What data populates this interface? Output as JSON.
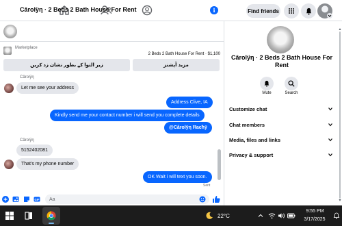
{
  "topnav": {
    "find_friends": "Find friends",
    "icons": [
      "home-icon",
      "friends-icon",
      "groups-icon",
      "menu-grid-icon",
      "messenger-icon",
      "notifications-icon",
      "profile-avatar"
    ]
  },
  "chat": {
    "title": "Cârolÿη · 2 Beds 2 Bath House For Rent",
    "info_icon": "i",
    "marketplace_label": "Marketplace",
    "listing": "2 Beds 2 Bath House For Rent · $1,100",
    "buttons": {
      "more_options": "مزید آپشنز",
      "mark_unavailable": "زیر التوا کے بطور نشان زد کریں"
    },
    "messages": [
      {
        "direction": "in",
        "sender": "Cârolÿη",
        "text": "Let me see your address"
      },
      {
        "direction": "out",
        "text": "Address Clive, IA"
      },
      {
        "direction": "out",
        "text": "Kindly send me your contact number i will send you complete details"
      },
      {
        "direction": "out",
        "text": "@Cârolÿη Ħacħÿ"
      },
      {
        "direction": "in",
        "sender": "Cârolÿη",
        "text": "5152402081"
      },
      {
        "direction": "in",
        "text": "That's my phone number"
      },
      {
        "direction": "out",
        "text": "OK Wait i will text you soon."
      }
    ],
    "status": "Sent",
    "composer_placeholder": "Aa"
  },
  "right_panel": {
    "title": "Cârolÿη · 2 Beds 2 Bath House For Rent",
    "actions": [
      {
        "label": "Mute",
        "icon": "bell-icon"
      },
      {
        "label": "Search",
        "icon": "search-icon"
      }
    ],
    "sections": [
      {
        "label": "Customize chat"
      },
      {
        "label": "Chat members"
      },
      {
        "label": "Media, files and links"
      },
      {
        "label": "Privacy & support"
      }
    ]
  },
  "taskbar": {
    "search_icon": "search-icon",
    "apps": [
      "file-explorer-icon",
      "chrome-icon"
    ],
    "weather": "22°C",
    "time": "9:55 PM",
    "date": "3/17/2025",
    "colors": {
      "accent": "#0866ff",
      "taskbar_bg": "#1c1c1c"
    }
  }
}
